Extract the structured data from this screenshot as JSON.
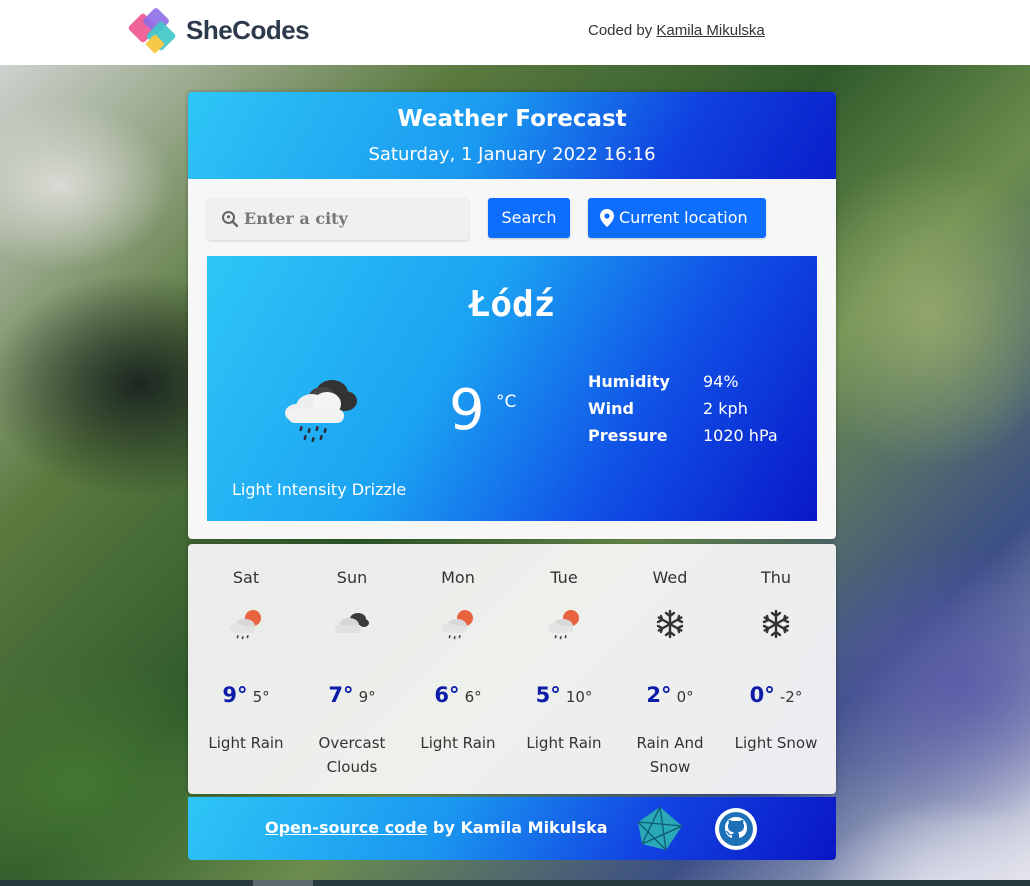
{
  "header": {
    "logo_text": "SheCodes",
    "credit_prefix": "Coded by",
    "credit_name": "Kamila Mikulska"
  },
  "card": {
    "title": "Weather Forecast",
    "datetime": "Saturday, 1 January 2022 16:16"
  },
  "search": {
    "placeholder": "Enter a city",
    "search_label": "Search",
    "location_label": "Current location"
  },
  "current": {
    "city": "Łódź",
    "temperature": "9",
    "unit": "°C",
    "description": "Light Intensity Drizzle",
    "icon": "cloud-drizzle-icon",
    "details": [
      {
        "label": "Humidity",
        "value": "94%"
      },
      {
        "label": "Wind",
        "value": "2 kph"
      },
      {
        "label": "Pressure",
        "value": "1020 hPa"
      }
    ]
  },
  "forecast": [
    {
      "day": "Sat",
      "hi": "9°",
      "lo": "5°",
      "condition": "Light Rain",
      "icon": "sun-cloud-rain-icon"
    },
    {
      "day": "Sun",
      "hi": "7°",
      "lo": "9°",
      "condition": "Overcast Clouds",
      "icon": "overcast-clouds-icon"
    },
    {
      "day": "Mon",
      "hi": "6°",
      "lo": "6°",
      "condition": "Light Rain",
      "icon": "sun-cloud-rain-icon"
    },
    {
      "day": "Tue",
      "hi": "5°",
      "lo": "10°",
      "condition": "Light Rain",
      "icon": "sun-cloud-rain-icon"
    },
    {
      "day": "Wed",
      "hi": "2°",
      "lo": "0°",
      "condition": "Rain And Snow",
      "icon": "snowflake-icon"
    },
    {
      "day": "Thu",
      "hi": "0°",
      "lo": "-2°",
      "condition": "Light Snow",
      "icon": "snowflake-icon"
    }
  ],
  "footer": {
    "link_text": "Open-source code",
    "by_text": " by Kamila Mikulska"
  },
  "colors": {
    "accent": "#0d6efd",
    "temp_high": "#0c1ba8",
    "gradient_start": "#2ec6f6",
    "gradient_end": "#0a18c8"
  }
}
